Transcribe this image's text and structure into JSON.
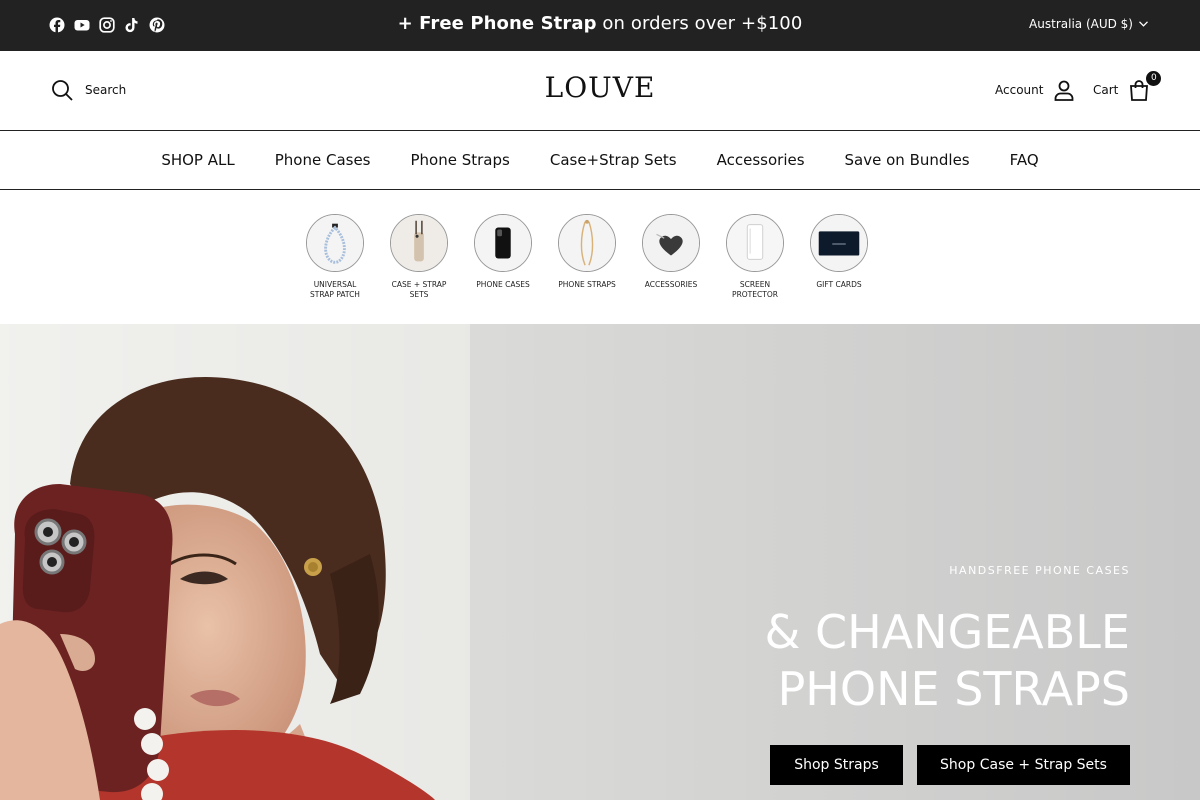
{
  "topbar": {
    "social_icons": [
      "facebook-icon",
      "youtube-icon",
      "instagram-icon",
      "tiktok-icon",
      "pinterest-icon"
    ],
    "announcement_bold": "+ Free Phone Strap",
    "announcement_rest": "on orders over +$100",
    "region": "Australia (AUD $)"
  },
  "header": {
    "search_label": "Search",
    "logo": "LOUVE",
    "account_label": "Account",
    "cart_label": "Cart",
    "cart_count": "0"
  },
  "nav": {
    "items": [
      "SHOP ALL",
      "Phone Cases",
      "Phone Straps",
      "Case+Strap Sets",
      "Accessories",
      "Save on Bundles",
      "FAQ"
    ]
  },
  "categories": [
    {
      "label": "UNIVERSAL STRAP PATCH"
    },
    {
      "label": "CASE + STRAP SETS"
    },
    {
      "label": "PHONE CASES"
    },
    {
      "label": "PHONE STRAPS"
    },
    {
      "label": "ACCESSORIES"
    },
    {
      "label": "SCREEN PROTECTOR"
    },
    {
      "label": "GIFT CARDS"
    }
  ],
  "hero": {
    "eyebrow": "HANDSFREE PHONE CASES",
    "title_line1": "& CHANGEABLE",
    "title_line2": "PHONE STRAPS",
    "button_straps": "Shop Straps",
    "button_sets": "Shop Case + Strap Sets"
  },
  "colors": {
    "topbar_bg": "#222222",
    "button_bg": "#000000"
  }
}
